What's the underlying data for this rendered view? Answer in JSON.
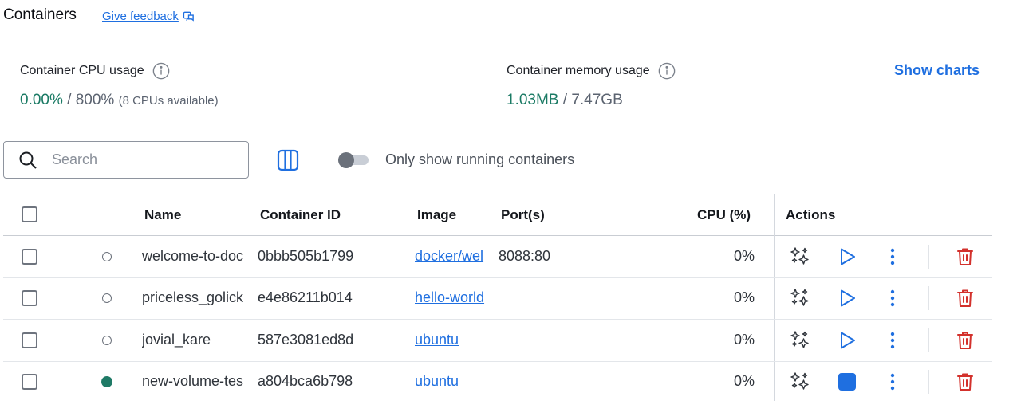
{
  "header": {
    "title": "Containers",
    "feedback_label": "Give feedback"
  },
  "stats": {
    "cpu_label": "Container CPU usage",
    "cpu_used": "0.00%",
    "cpu_total": " / 800%",
    "cpu_note": "(8 CPUs available)",
    "memory_label": "Container memory usage",
    "memory_used": "1.03MB",
    "memory_total": " / 7.47GB",
    "show_charts_label": "Show charts"
  },
  "toolbar": {
    "search_placeholder": "Search",
    "toggle_label": "Only show running containers",
    "toggle_on": false
  },
  "table": {
    "headers": {
      "name": "Name",
      "id": "Container ID",
      "image": "Image",
      "ports": "Port(s)",
      "cpu": "CPU (%)",
      "actions": "Actions"
    },
    "rows": [
      {
        "name": "welcome-to-doc",
        "id": "0bbb505b1799",
        "image": "docker/wel",
        "port": "8088:80",
        "cpu": "0%",
        "running": false
      },
      {
        "name": "priceless_golick",
        "id": "e4e86211b014",
        "image": "hello-world",
        "port": "",
        "cpu": "0%",
        "running": false
      },
      {
        "name": "jovial_kare",
        "id": "587e3081ed8d",
        "image": "ubuntu",
        "port": "",
        "cpu": "0%",
        "running": false
      },
      {
        "name": "new-volume-tes",
        "id": "a804bca6b798",
        "image": "ubuntu",
        "port": "",
        "cpu": "0%",
        "running": true
      }
    ]
  },
  "colors": {
    "accent": "#1f6fe0",
    "running": "#1f7a66",
    "delete": "#d3312c",
    "stop": "#1f6fe0"
  },
  "icons": {
    "ai": "sparkles-icon",
    "start": "play-icon",
    "stop": "stop-icon",
    "more": "more-vertical-icon",
    "delete": "trash-icon"
  }
}
